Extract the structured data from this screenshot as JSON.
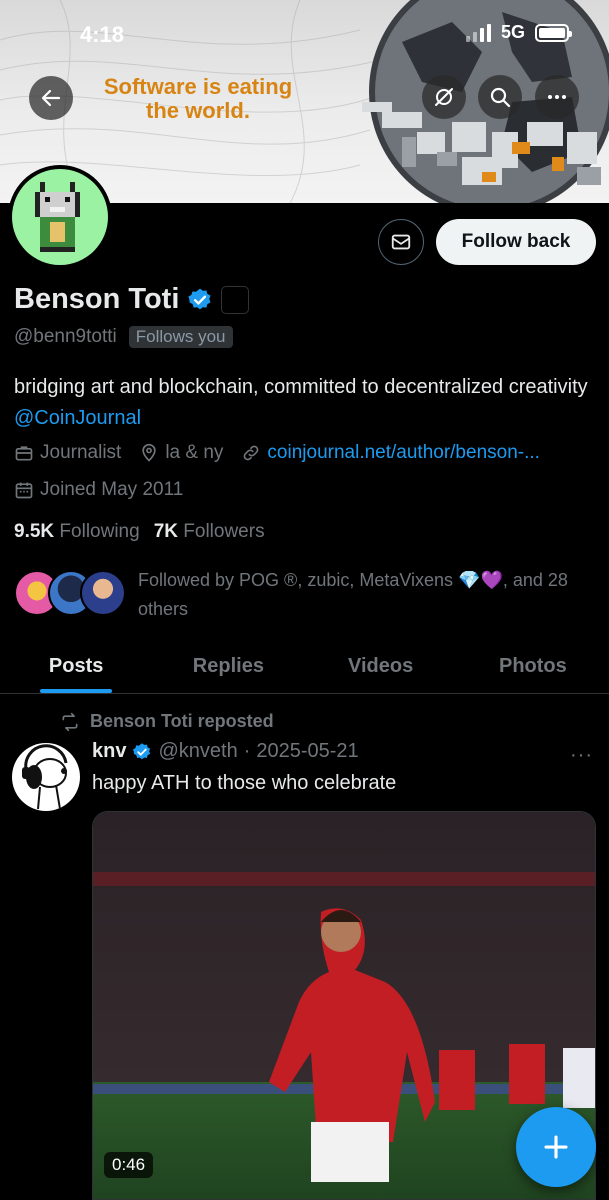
{
  "status_bar": {
    "time": "4:18",
    "network": "5G"
  },
  "banner": {
    "headline": "Software is eating the world."
  },
  "header_icons": {
    "back": "arrow-left-icon",
    "grok": "grok-icon",
    "search": "search-icon",
    "more": "more-dots-icon"
  },
  "profile": {
    "name": "Benson Toti",
    "handle": "@benn9totti",
    "follows_you": "Follows you",
    "follow_button": "Follow back",
    "bio_text": "bridging art and blockchain, committed to decentralized creativity ",
    "bio_mention": "@CoinJournal",
    "profession": "Journalist",
    "location": "la & ny",
    "website": "coinjournal.net/author/benson-...",
    "joined": "Joined May 2011",
    "following_count": "9.5K",
    "following_label": "Following",
    "followers_count": "7K",
    "followers_label": "Followers",
    "followed_by_text": "Followed by POG ®, zubic, MetaVixens 💎💜, and 28 others"
  },
  "tabs": [
    "Posts",
    "Replies",
    "Videos",
    "Photos"
  ],
  "post": {
    "repost_label": "Benson Toti reposted",
    "author_name": "knv",
    "author_handle": "@knveth",
    "separator": "·",
    "date": "2025-05-21",
    "more": "···",
    "text": "happy ATH to those who celebrate",
    "video_duration": "0:46"
  },
  "colors": {
    "accent": "#1d9bf0",
    "background": "#000000",
    "muted": "#71767b",
    "banner_text": "#d88413"
  }
}
